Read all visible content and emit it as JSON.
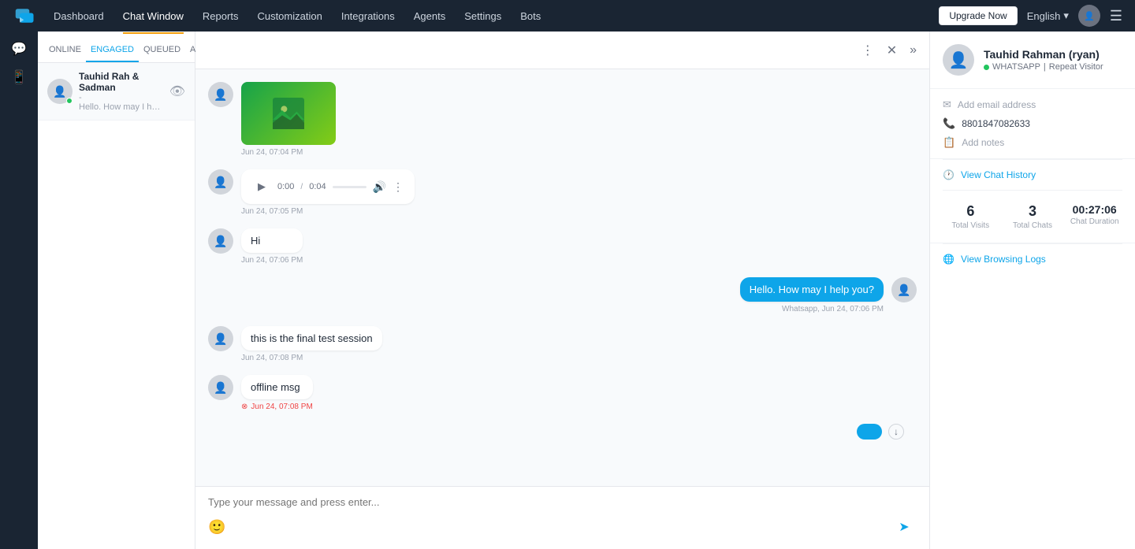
{
  "nav": {
    "links": [
      "Dashboard",
      "Chat Window",
      "Reports",
      "Customization",
      "Integrations",
      "Agents",
      "Settings",
      "Bots"
    ],
    "active": "Chat Window",
    "upgrade_label": "Upgrade Now",
    "lang": "English",
    "lang_arrow": "▾"
  },
  "chat_tabs": [
    "ONLINE",
    "ENGAGED",
    "QUEUED",
    "AGENT"
  ],
  "active_chat_tab": "ENGAGED",
  "chat_list": [
    {
      "name": "Tauhid Rah & Sadman",
      "preview": "Hello. How may I help you?...",
      "online": true
    }
  ],
  "toolbar": {
    "more_icon": "⋮",
    "close_icon": "✕",
    "expand_icon": "»"
  },
  "messages": [
    {
      "id": "img-msg",
      "type": "image",
      "time": "Jun 24, 07:04 PM",
      "direction": "incoming"
    },
    {
      "id": "audio-msg",
      "type": "audio",
      "duration": "0:04",
      "current": "0:00",
      "time": "Jun 24, 07:05 PM",
      "direction": "incoming"
    },
    {
      "id": "hi-msg",
      "type": "text",
      "text": "Hi",
      "time": "Jun 24, 07:06 PM",
      "direction": "incoming"
    },
    {
      "id": "greet-msg",
      "type": "text",
      "text": "Hello. How may I help you?",
      "time": "Whatsapp, Jun 24, 07:06 PM",
      "direction": "outgoing"
    },
    {
      "id": "test-msg",
      "type": "text",
      "text": "this is the final test session",
      "time": "Jun 24, 07:08 PM",
      "direction": "incoming"
    },
    {
      "id": "offline-msg",
      "type": "text",
      "text": "offline msg",
      "time": "Jun 24, 07:08 PM",
      "direction": "incoming",
      "offline": true
    }
  ],
  "chat_input_placeholder": "Type your message and press enter...",
  "visitor": {
    "name": "Tauhid Rahman (ryan)",
    "platform": "WHATSAPP",
    "visitor_type": "Repeat Visitor",
    "email_placeholder": "Add email address",
    "phone": "8801847082633",
    "notes_placeholder": "Add notes",
    "total_visits": "6",
    "total_visits_label": "Total Visits",
    "total_chats": "3",
    "total_chats_label": "Total Chats",
    "chat_duration": "00:27:06",
    "chat_duration_label": "Chat Duration",
    "view_history_label": "View Chat History",
    "view_logs_label": "View Browsing Logs"
  }
}
